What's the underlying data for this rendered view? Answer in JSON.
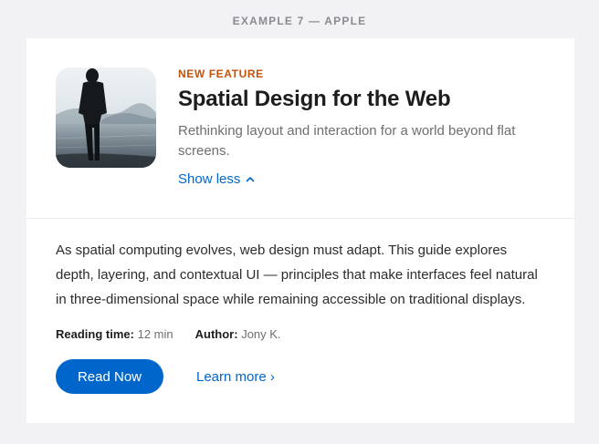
{
  "header": {
    "example_label": "EXAMPLE 7 — APPLE"
  },
  "card": {
    "eyebrow": "NEW FEATURE",
    "title": "Spatial Design for the Web",
    "subtitle": "Rethinking layout and interaction for a world beyond flat screens.",
    "toggle_label": "Show less",
    "body": "As spatial computing evolves, web design must adapt. This guide explores depth, layering, and contextual UI — principles that make interfaces feel natural in three-dimensional space while remaining accessible on traditional displays.",
    "meta": {
      "reading_time_label": "Reading time:",
      "reading_time_value": "12 min",
      "author_label": "Author:",
      "author_value": "Jony K."
    },
    "primary_button": "Read Now",
    "secondary_link": "Learn more ›"
  },
  "colors": {
    "accent": "#0066cc",
    "eyebrow": "#c4530c",
    "background": "#f2f2f4"
  },
  "icons": {
    "toggle": "chevron-up-icon"
  }
}
